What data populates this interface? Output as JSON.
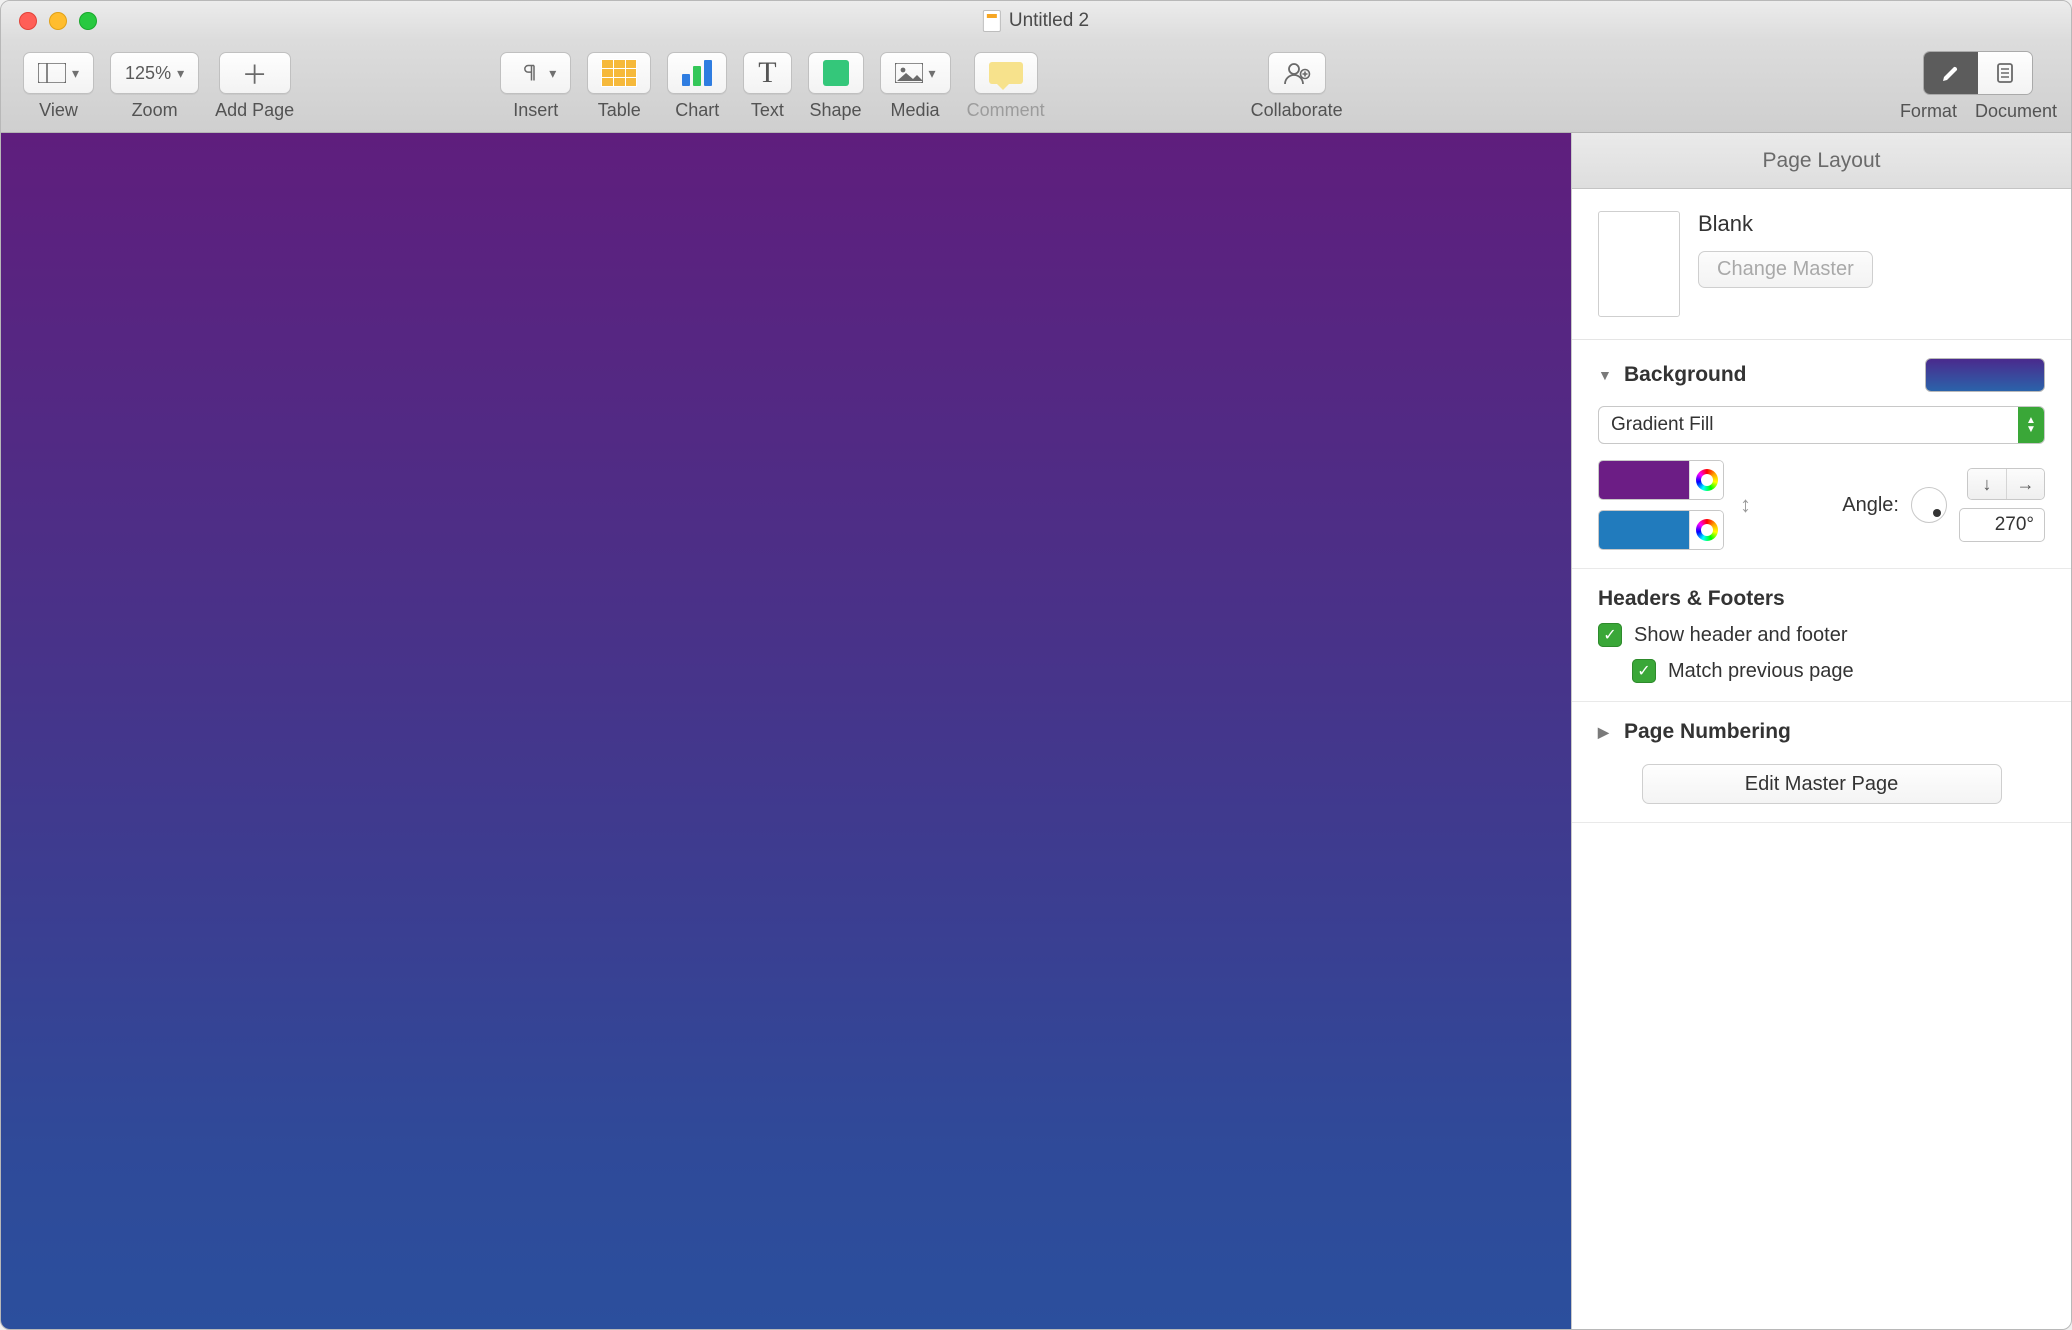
{
  "window": {
    "title": "Untitled 2"
  },
  "toolbar": {
    "view": "View",
    "zoom_value": "125%",
    "zoom": "Zoom",
    "add_page": "Add Page",
    "insert": "Insert",
    "table": "Table",
    "chart": "Chart",
    "text": "Text",
    "shape": "Shape",
    "media": "Media",
    "comment": "Comment",
    "collaborate": "Collaborate",
    "format": "Format",
    "document": "Document"
  },
  "inspector": {
    "title": "Page Layout",
    "master": {
      "name": "Blank",
      "change_button": "Change Master"
    },
    "background": {
      "label": "Background",
      "fill_type": "Gradient Fill",
      "angle_label": "Angle:",
      "angle_value": "270°"
    },
    "headers": {
      "label": "Headers & Footers",
      "show": "Show header and footer",
      "match": "Match previous page"
    },
    "page_numbering": {
      "label": "Page Numbering"
    },
    "edit_master": "Edit Master Page"
  }
}
